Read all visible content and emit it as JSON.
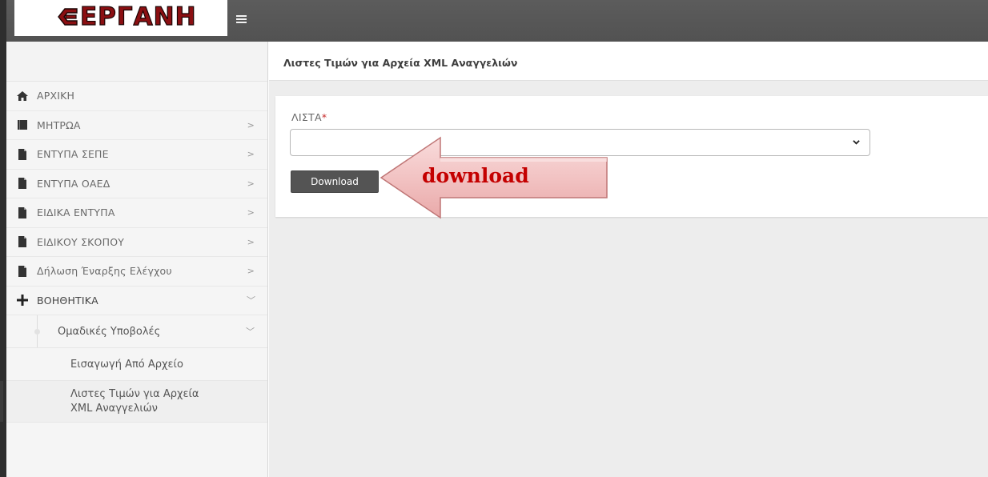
{
  "app": {
    "logo_text": "ΕΡΓΑΝΗ",
    "brand_color": "#8b0f12"
  },
  "sidebar": {
    "items": [
      {
        "label": "ΑΡΧΙΚΗ",
        "icon": "home-icon",
        "chevron": ""
      },
      {
        "label": "ΜΗΤΡΩΑ",
        "icon": "book-icon",
        "chevron": ">"
      },
      {
        "label": "ΕΝΤΥΠΑ ΣΕΠΕ",
        "icon": "document-icon",
        "chevron": ">"
      },
      {
        "label": "ΕΝΤΥΠΑ ΟΑΕΔ",
        "icon": "document-icon",
        "chevron": ">"
      },
      {
        "label": "ΕΙΔΙΚΑ ΕΝΤΥΠΑ",
        "icon": "document-icon",
        "chevron": ">"
      },
      {
        "label": "ΕΙΔΙΚΟΥ ΣΚΟΠΟΥ",
        "icon": "document-icon",
        "chevron": ">"
      },
      {
        "label": "Δήλωση Έναρξης Ελέγχου",
        "icon": "document-icon",
        "chevron": ">"
      },
      {
        "label": "ΒΟΗΘΗΤΙΚΑ",
        "icon": "plus-icon",
        "chevron": "﹀"
      }
    ],
    "sub_group": {
      "label": "Ομαδικές Υποβολές",
      "chevron": "﹀"
    },
    "leaves": [
      {
        "label": "Εισαγωγή Από Αρχείο",
        "active": false
      },
      {
        "label_line1": "Λιστες Τιμών για Αρχεία",
        "label_line2": "XML Αναγγελιών",
        "active": true
      }
    ]
  },
  "main": {
    "page_title": "Λιστες Τιμών για Αρχεία XML Αναγγελιών",
    "form": {
      "list_label": "ΛΙΣΤΑ",
      "required_mark": "*",
      "list_value": "",
      "download_label": "Download"
    }
  },
  "annotation": {
    "text": "download",
    "color": "#c40000"
  }
}
